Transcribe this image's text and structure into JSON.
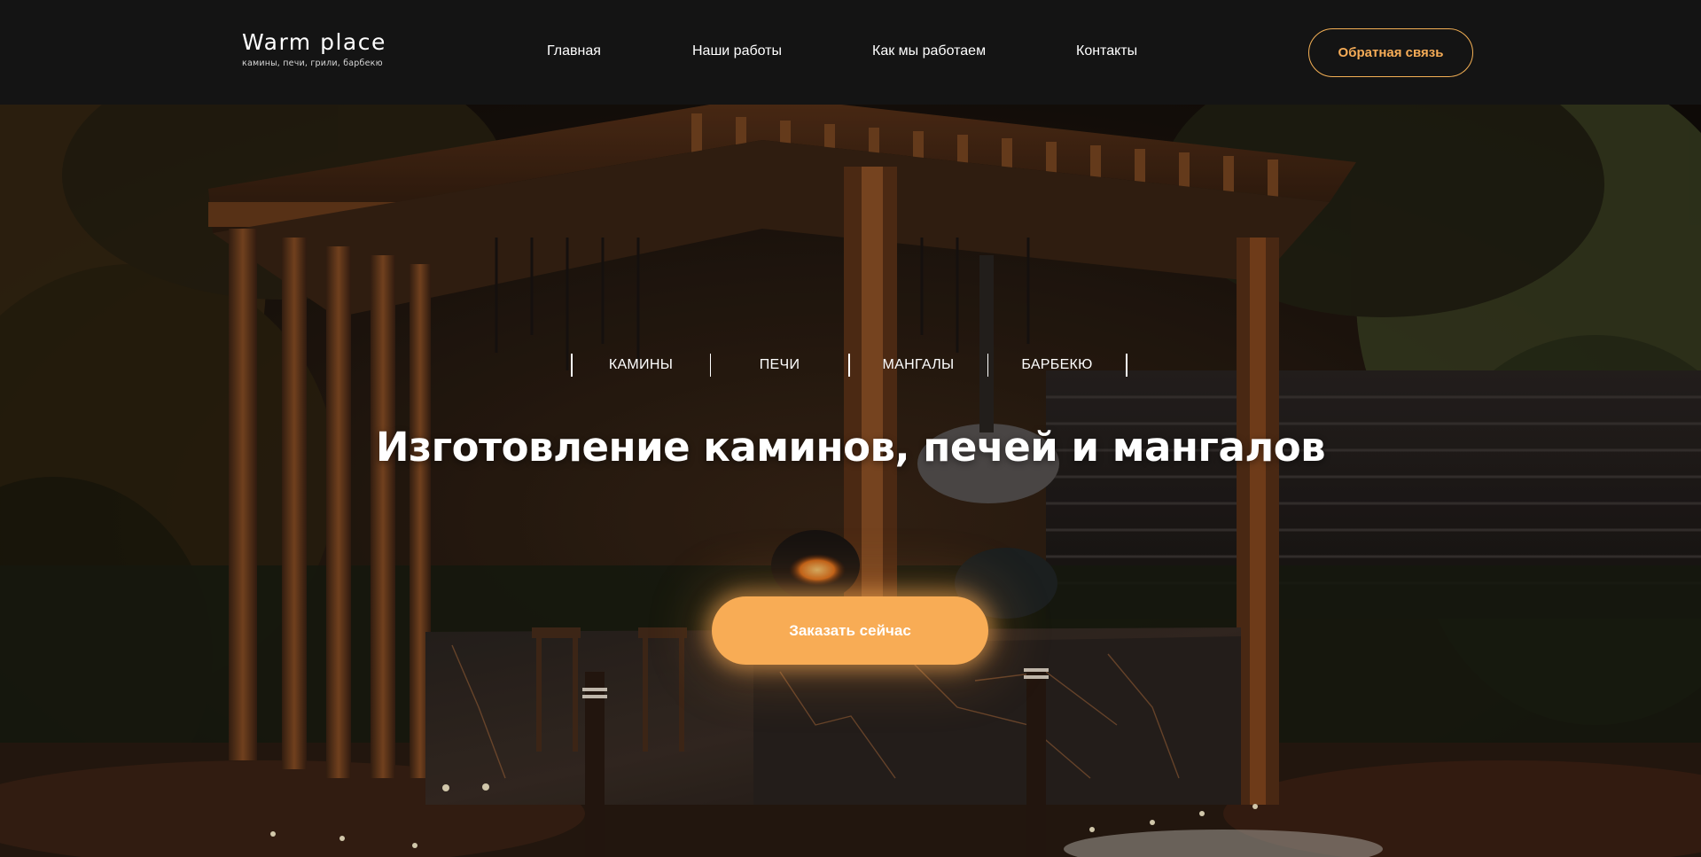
{
  "header": {
    "logo": {
      "title": "Warm place",
      "subtitle": "камины, печи, грили, барбекю"
    },
    "nav": [
      {
        "label": "Главная"
      },
      {
        "label": "Наши работы"
      },
      {
        "label": "Как мы работаем"
      },
      {
        "label": "Контакты"
      }
    ],
    "feedback_label": "Обратная связь"
  },
  "hero": {
    "categories": [
      {
        "label": "КАМИНЫ"
      },
      {
        "label": "ПЕЧИ"
      },
      {
        "label": "МАНГАЛЫ"
      },
      {
        "label": "БАРБЕКЮ"
      }
    ],
    "title": "Изготовление каминов, печей и мангалов",
    "cta_label": "Заказать сейчас"
  },
  "colors": {
    "header_bg": "#141414",
    "accent": "#f8ac55",
    "text": "#ffffff"
  }
}
